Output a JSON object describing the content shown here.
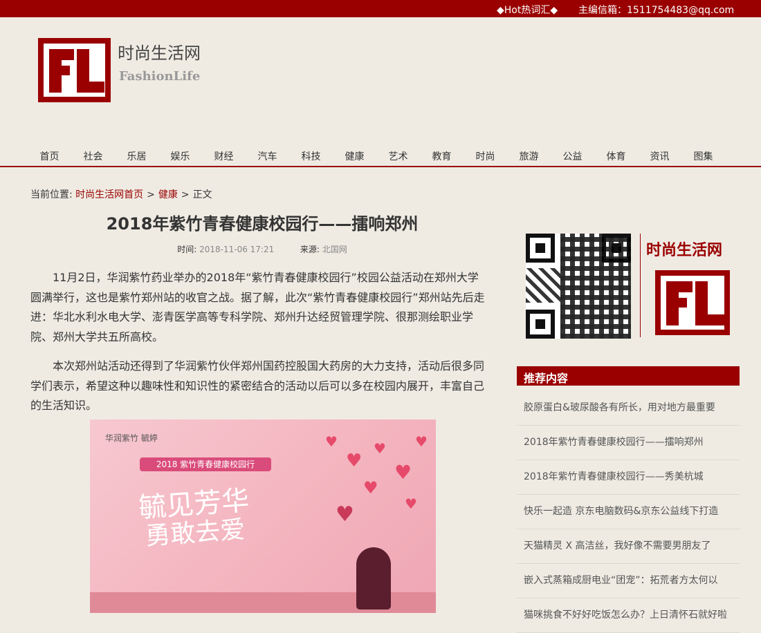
{
  "topbar": {
    "hot": "◆Hot热词汇◆",
    "editor_label": "主编信箱：",
    "editor_email": "1511754483@qq.com"
  },
  "site": {
    "name_cn": "时尚生活网",
    "name_en": "FashionLife"
  },
  "nav": [
    "首页",
    "社会",
    "乐居",
    "娱乐",
    "财经",
    "汽车",
    "科技",
    "健康",
    "艺术",
    "教育",
    "时尚",
    "旅游",
    "公益",
    "体育",
    "资讯",
    "图集"
  ],
  "breadcrumb": {
    "label": "当前位置:",
    "home": "时尚生活网首页",
    "sep": ">",
    "category": "健康",
    "current": "正文"
  },
  "article": {
    "title": "2018年紫竹青春健康校园行——擂响郑州",
    "time_label": "时间:",
    "time": "2018-11-06 17:21",
    "source_label": "来源:",
    "source": "北国网",
    "paragraphs": [
      "11月2日，华润紫竹药业举办的2018年“紫竹青春健康校园行”校园公益活动在郑州大学圆满举行，这也是紫竹郑州站的收官之战。据了解，此次“紫竹青春健康校园行”郑州站先后走进：华北水利水电大学、澎青医学高等专科学院、郑州升达经贸管理学院、很那测绘职业学院、郑州大学共五所高校。",
      "本次郑州站活动还得到了华润紫竹伙伴郑州国药控股国大药房的大力支持，活动后很多同学们表示，希望这种以趣味性和知识性的紧密结合的活动以后可以多在校园内展开，丰富自己的生活知识。"
    ]
  },
  "promo": {
    "brand": "华润紫竹 毓婷",
    "banner": "2018 紫竹青春健康校园行",
    "line1": "毓见芳华",
    "line2": "勇敢去爱"
  },
  "sidebar": {
    "brand": "时尚生活网",
    "recommend_title": "推荐内容",
    "recommend": [
      "胶原蛋白&玻尿酸各有所长，用对地方最重要",
      "2018年紫竹青春健康校园行——擂响郑州",
      "2018年紫竹青春健康校园行——秀美杭城",
      "快乐一起造 京东电脑数码&京东公益线下打造",
      "天猫精灵 X 高洁丝，我好像不需要男朋友了",
      "嵌入式蒸箱成厨电业“团宠”：拓荒者方太何以",
      "猫咪挑食不好好吃饭怎么办？上日清怀石就好啦"
    ]
  }
}
